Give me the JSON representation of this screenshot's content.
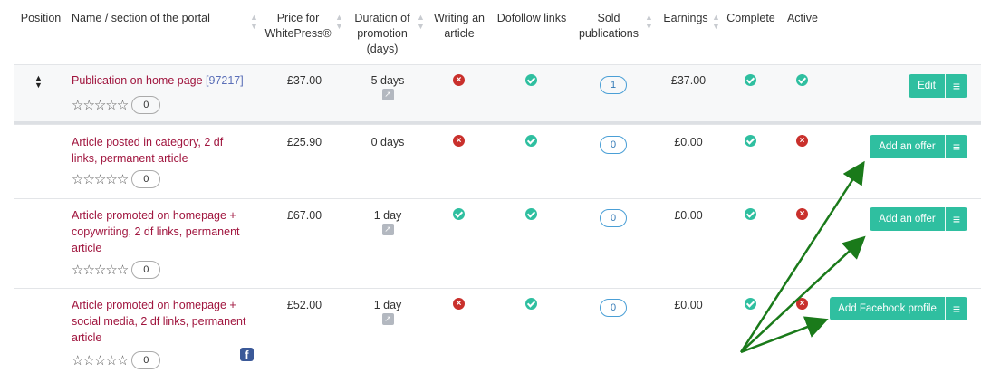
{
  "columns": {
    "position": "Position",
    "name_1": "Name / section of the portal",
    "price_1": "Price for",
    "price_2": "WhitePress®",
    "duration_1": "Duration of",
    "duration_2": "promotion",
    "duration_3": "(days)",
    "writing_1": "Writing an",
    "writing_2": "article",
    "dofollow": "Dofollow links",
    "sold_1": "Sold",
    "sold_2": "publications",
    "earnings": "Earnings",
    "complete": "Complete",
    "active": "Active"
  },
  "icons": {
    "check": "check-circle-icon",
    "cross": "cross-circle-icon",
    "external": "external-link-icon",
    "facebook": "facebook-icon",
    "menu": "hamburger-menu-icon",
    "sort": "sort-icon"
  },
  "colors": {
    "accent": "#2fbfa0",
    "name": "#a0153e",
    "error": "#c9302c",
    "arrow": "#1a7a1a"
  },
  "rows": [
    {
      "name_lines": [
        "Publication on home page "
      ],
      "id": "[97217]",
      "rating_count": "0",
      "price": "£37.00",
      "duration": "5 days",
      "sold": "1",
      "earnings": "£37.00",
      "writing": false,
      "dofollow": true,
      "complete": true,
      "active": true,
      "action": "Edit",
      "facebook": false
    },
    {
      "name_lines": [
        "Article posted in category, 2 df",
        "links, permanent article"
      ],
      "rating_count": "0",
      "price": "£25.90",
      "duration": "0 days",
      "sold": "0",
      "earnings": "£0.00",
      "writing": false,
      "dofollow": true,
      "complete": true,
      "active": false,
      "action": "Add an offer",
      "facebook": false
    },
    {
      "name_lines": [
        "Article promoted on homepage +",
        "copywriting, 2 df links, permanent",
        "article"
      ],
      "rating_count": "0",
      "price": "£67.00",
      "duration": "1 day",
      "sold": "0",
      "earnings": "£0.00",
      "writing": true,
      "dofollow": true,
      "complete": true,
      "active": false,
      "action": "Add an offer",
      "facebook": false
    },
    {
      "name_lines": [
        "Article promoted on homepage +",
        "social media, 2 df links, permanent",
        "article"
      ],
      "rating_count": "0",
      "price": "£52.00",
      "duration": "1 day",
      "sold": "0",
      "earnings": "£0.00",
      "writing": false,
      "dofollow": true,
      "complete": true,
      "active": false,
      "action": "Add Facebook profile",
      "facebook": true
    }
  ]
}
